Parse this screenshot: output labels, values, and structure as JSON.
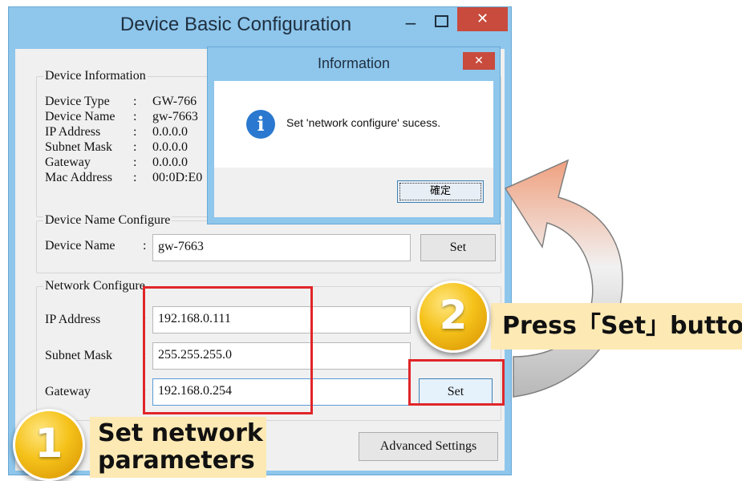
{
  "window": {
    "title": "Device Basic Configuration",
    "minimize_glyph": "−",
    "close_glyph": "✕"
  },
  "device_info": {
    "legend": "Device Information",
    "rows": [
      {
        "label": "Device Type",
        "sep": ":",
        "value": "GW-766"
      },
      {
        "label": "Device Name",
        "sep": ":",
        "value": "gw-7663"
      },
      {
        "label": "IP Address",
        "sep": ":",
        "value": "0.0.0.0"
      },
      {
        "label": "Subnet Mask",
        "sep": ":",
        "value": "0.0.0.0"
      },
      {
        "label": "Gateway",
        "sep": ":",
        "value": "0.0.0.0"
      },
      {
        "label": "Mac Address",
        "sep": ":",
        "value": "00:0D:E0"
      }
    ]
  },
  "name_config": {
    "legend": "Device Name Configure",
    "label": "Device Name",
    "sep": ":",
    "value": "gw-7663",
    "set_label": "Set"
  },
  "network_config": {
    "legend": "Network Configure",
    "ip_label": "IP Address",
    "ip_value": "192.168.0.111",
    "mask_label": "Subnet Mask",
    "mask_value": "255.255.255.0",
    "gw_label": "Gateway",
    "gw_value": "192.168.0.254",
    "sep": ":",
    "set_label": "Set"
  },
  "advanced_label": "Advanced Settings",
  "dialog": {
    "title": "Information",
    "close_glyph": "✕",
    "icon": "info-icon",
    "icon_glyph": "i",
    "message": "Set 'network configure' sucess.",
    "ok_label": "確定"
  },
  "annotations": {
    "step1_number": "1",
    "step1_line1": "Set network",
    "step1_line2": "parameters",
    "step2_number": "2",
    "step2_text": "Press「Set」button"
  },
  "colors": {
    "highlight_red": "#e0262a",
    "badge_gold": "#f5c21a",
    "callout_bg": "#fde9b4",
    "title_bar": "#8ec6ec",
    "close_red": "#c84b3d"
  }
}
